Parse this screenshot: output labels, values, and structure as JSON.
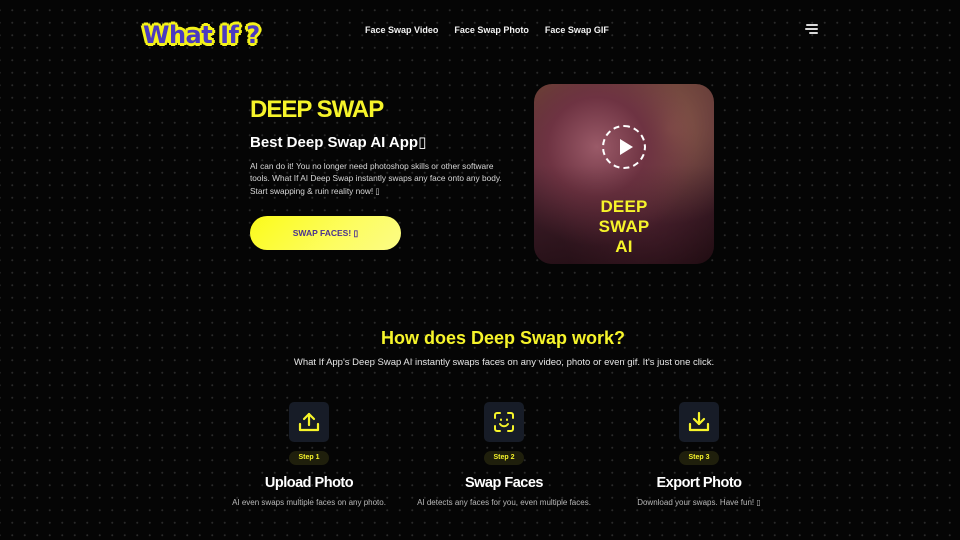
{
  "header": {
    "logo_text": "What If ?",
    "nav": [
      {
        "label": "Face Swap Video"
      },
      {
        "label": "Face Swap Photo"
      },
      {
        "label": "Face Swap GIF"
      }
    ],
    "menu_icon": "hamburger-menu-icon"
  },
  "hero": {
    "title": "DEEP SWAP",
    "subtitle": "Best Deep Swap AI App▯",
    "description": "AI can do it! You no longer need photoshop skills or other software tools. What If AI Deep Swap instantly swaps any face onto any body. Start swapping & ruin reality now! ▯",
    "cta_label": "SWAP FACES! ▯",
    "video": {
      "caption_lines": [
        "DEEP",
        "SWAP",
        "AI"
      ],
      "play_icon": "play-icon"
    }
  },
  "how": {
    "title": "How does Deep Swap work?",
    "description": "What If App's Deep Swap AI instantly swaps faces on any video, photo or even gif. It's just one click.",
    "steps": [
      {
        "badge": "Step 1",
        "title": "Upload Photo",
        "desc": "AI even swaps multiple faces on any photo.",
        "icon": "upload-icon"
      },
      {
        "badge": "Step 2",
        "title": "Swap Faces",
        "desc": "AI detects any faces for you, even multiple faces.",
        "icon": "face-scan-icon"
      },
      {
        "badge": "Step 3",
        "title": "Export Photo",
        "desc": "Download your swaps. Have fun! ▯",
        "icon": "download-icon"
      }
    ]
  },
  "colors": {
    "background": "#050505",
    "accent_yellow": "#f6f42a",
    "logo_purple": "#4b3ac0",
    "cta_text": "#4a3290",
    "icon_box": "#171c27"
  }
}
